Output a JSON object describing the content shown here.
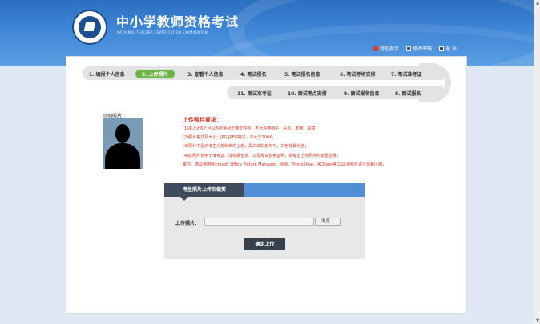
{
  "header": {
    "title": "中小学教师资格考试",
    "subtitle": "NATIONAL TEACHER CERTIFICATION EXAMINATION",
    "links": [
      {
        "label": "特别提示",
        "icon": "notice-icon",
        "color": "#e0402a"
      },
      {
        "label": "修改密码",
        "icon": "password-icon",
        "color": "#2a5a9a"
      },
      {
        "label": "退 出",
        "icon": "logout-icon",
        "color": "#444444"
      }
    ]
  },
  "steps": {
    "row1": [
      "1. 填报个人信息",
      "2. 上传照片",
      "3. 查看个人信息",
      "4. 笔试报名",
      "5. 笔试报名信息",
      "6. 笔试考场安排",
      "7. 笔试准考证"
    ],
    "row2": [
      "8. 面试报名",
      "9. 面试报名信息",
      "10. 面试考点安排",
      "11. 面试准考证"
    ],
    "active_index": 1
  },
  "example": {
    "label": "示例照片："
  },
  "requirements": {
    "title": "上传照片要求：",
    "items": [
      "(1)本人近6个月以内的免冠正面证件照；不允许带帽子、头巾、发带、墨镜；",
      "(2)照片格式及大小：JPG/JPEG格式，不大于200K；",
      "(3)照片中显示考生头部和肩的上部；黑白或彩色均可，白色背景为佳；",
      "(4)此照片将用于准考证、成绩报告单、以及考试合格证明，请考生上传照片时慎重选择；",
      "备注：建议使用Microsoft Office Picture Manager、图图、PhotoShop、ACDsee等工具,将照片进行剪裁压缩；"
    ]
  },
  "upload": {
    "tab_label": "考生照片上传及裁剪",
    "file_label": "上传照片：",
    "browse_label": "浏览...",
    "submit_label": "确定上传"
  },
  "colors": {
    "header_blue": "#3f86d6",
    "active_step": "#6db445",
    "requirement_red": "#dd3322",
    "submit_dark": "#37404b"
  }
}
